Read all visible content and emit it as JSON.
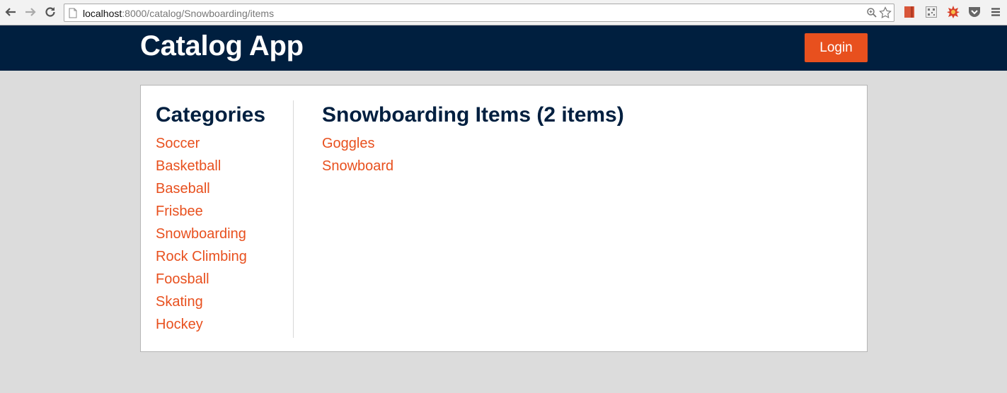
{
  "browser": {
    "url_host": "localhost",
    "url_rest": ":8000/catalog/Snowboarding/items"
  },
  "header": {
    "title": "Catalog App",
    "login_label": "Login"
  },
  "sidebar": {
    "heading": "Categories",
    "categories": [
      {
        "label": "Soccer"
      },
      {
        "label": "Basketball"
      },
      {
        "label": "Baseball"
      },
      {
        "label": "Frisbee"
      },
      {
        "label": "Snowboarding"
      },
      {
        "label": "Rock Climbing"
      },
      {
        "label": "Foosball"
      },
      {
        "label": "Skating"
      },
      {
        "label": "Hockey"
      }
    ]
  },
  "main": {
    "heading": "Snowboarding Items (2 items)",
    "items": [
      {
        "label": "Goggles"
      },
      {
        "label": "Snowboard"
      }
    ]
  },
  "colors": {
    "navbar": "#001f3f",
    "accent": "#e8501e",
    "background": "#dcdcdc"
  }
}
